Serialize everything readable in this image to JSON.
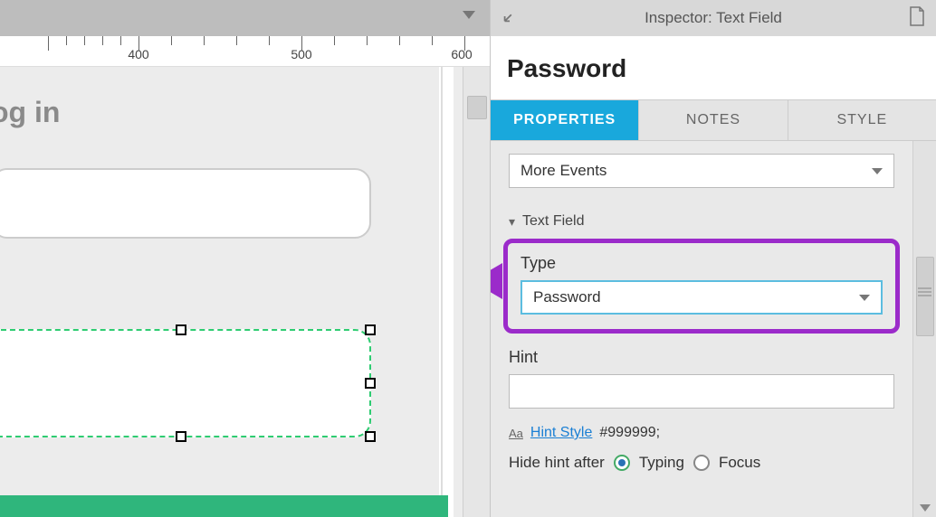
{
  "canvas": {
    "ruler_marks": [
      "400",
      "500",
      "600"
    ],
    "page_title": "og in"
  },
  "inspector": {
    "header_title": "Inspector: Text Field",
    "widget_name": "Password",
    "tabs": {
      "properties": "PROPERTIES",
      "notes": "NOTES",
      "style": "STYLE"
    },
    "more_events": "More Events",
    "section_text_field": "Text Field",
    "type_label": "Type",
    "type_value": "Password",
    "hint_label": "Hint",
    "hint_value": "",
    "hint_style_link": "Hint Style",
    "hint_style_value": "#999999;",
    "hide_hint_label": "Hide hint after",
    "hide_hint_options": {
      "typing": "Typing",
      "focus": "Focus"
    },
    "hide_hint_selected": "typing"
  },
  "colors": {
    "accent": "#19a8dc",
    "highlight": "#9b2bca",
    "green": "#2fb67c"
  }
}
